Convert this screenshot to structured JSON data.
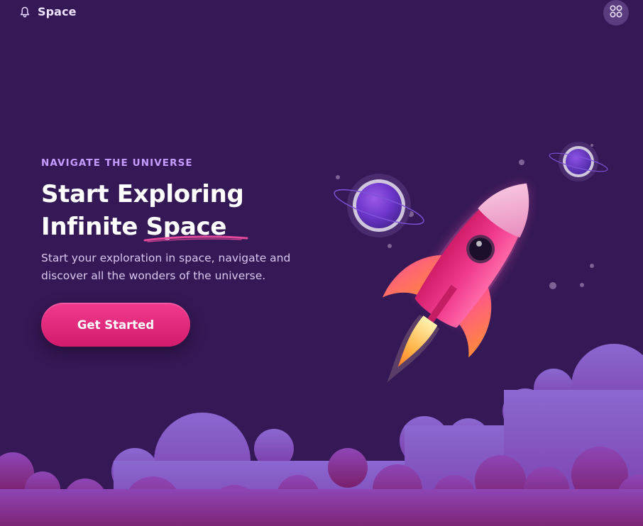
{
  "header": {
    "brand_name": "Space",
    "brand_icon": "bell-icon",
    "menu_icon": "grid-icon"
  },
  "hero": {
    "eyebrow": "NAVIGATE THE UNIVERSE",
    "title_line1": "Start Exploring",
    "title_line2_prefix": "Infinite ",
    "title_highlight": "Space",
    "subtitle_line1": "Start your exploration in space, navigate and",
    "subtitle_line2": "discover all the wonders of the universe.",
    "cta_label": "Get Started"
  },
  "colors": {
    "background": "#351856",
    "accent": "#e92c7f",
    "eyebrow": "#c59cff",
    "cloud_light": "#8a63cf",
    "cloud_dark": "#7a1f6e"
  }
}
